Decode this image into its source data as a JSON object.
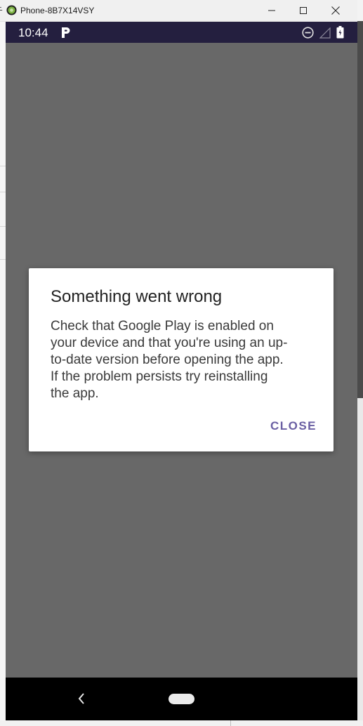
{
  "window": {
    "title": "Phone-8B7X14VSY",
    "left_glyph": "斤"
  },
  "status_bar": {
    "time": "10:44",
    "icons": [
      "parking-p-icon",
      "do-not-disturb-icon",
      "signal-icon",
      "battery-icon"
    ]
  },
  "dialog": {
    "title": "Something went wrong",
    "message": "Check that Google Play is enabled on your device and that you're using an up-to-date version before opening the app. If the problem persists try reinstalling the app.",
    "close_label": "CLOSE"
  },
  "nav_bar": {
    "icons": [
      "back-icon",
      "home-pill-icon"
    ]
  },
  "colors": {
    "status_bar": "#241f3f",
    "scrim": "#686868",
    "accent": "#6a5fa3",
    "nav_bar": "#000000"
  }
}
